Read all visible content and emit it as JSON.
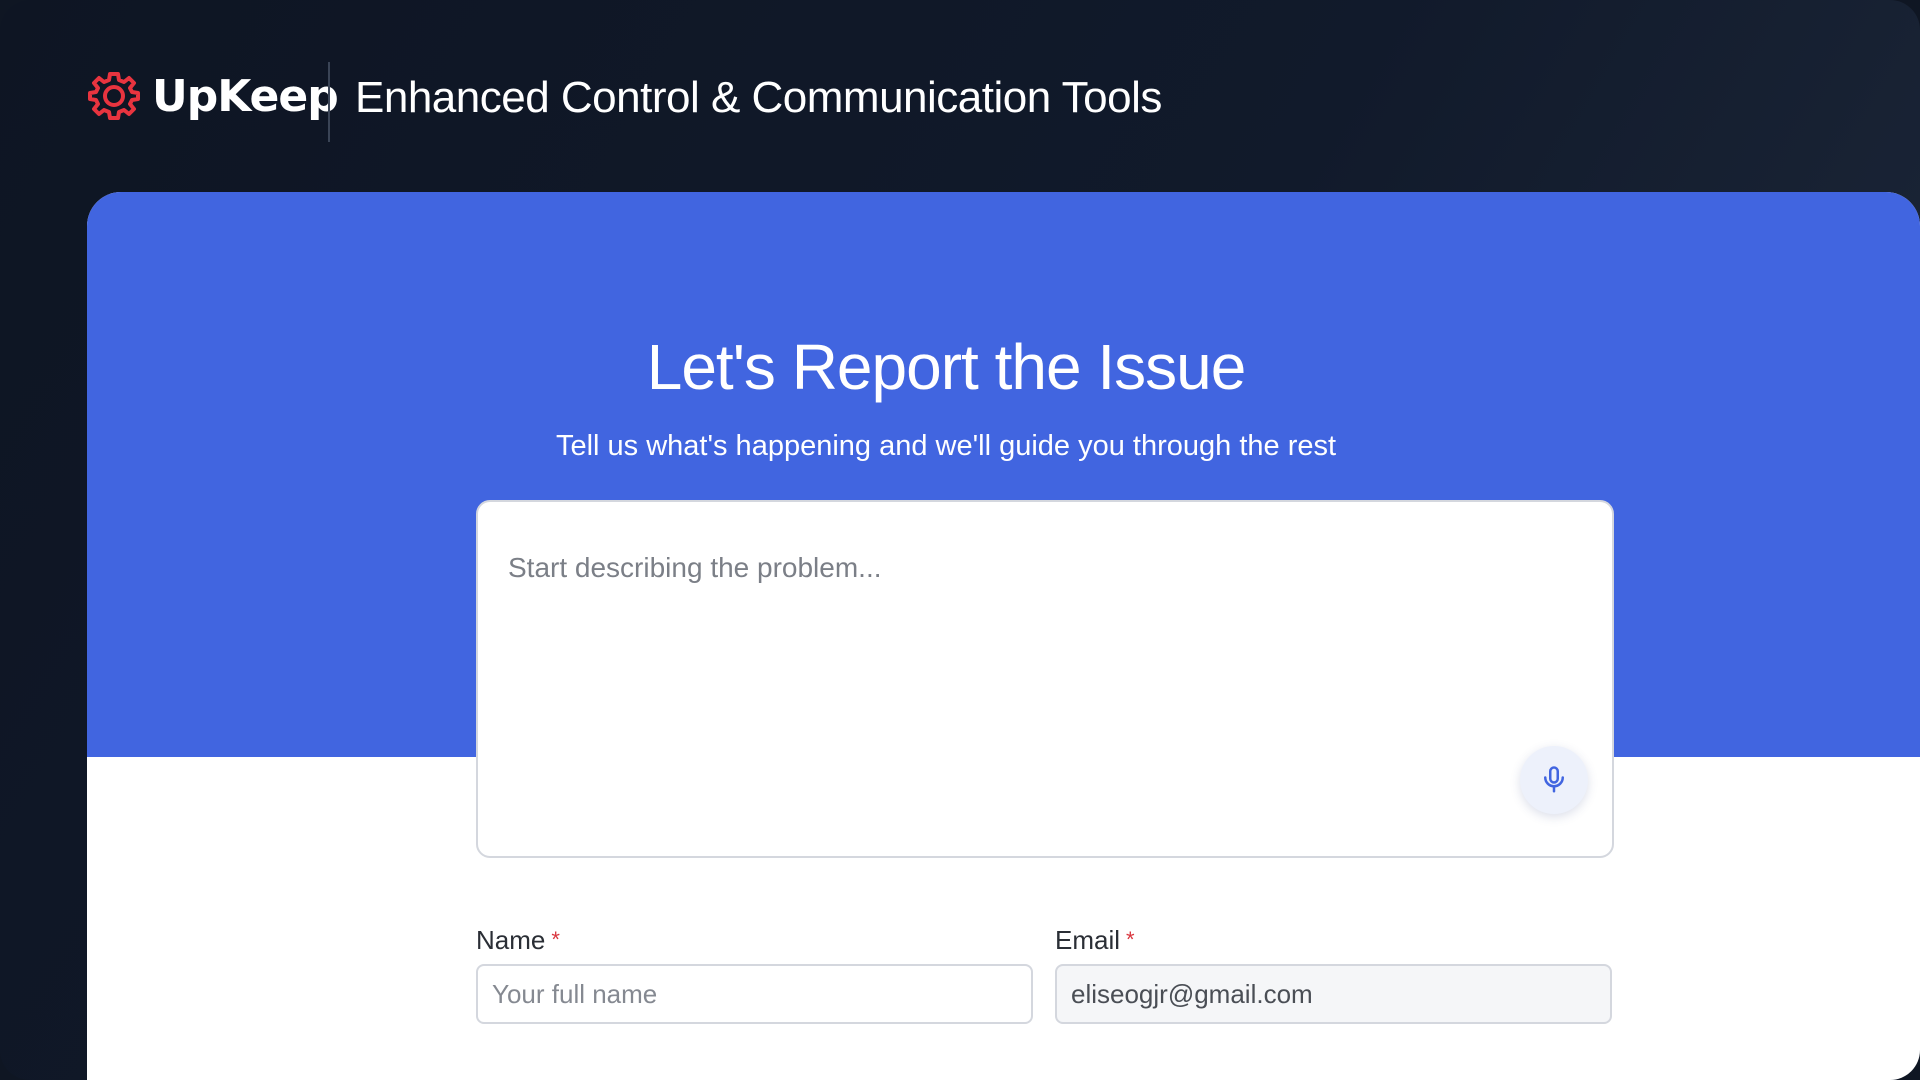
{
  "app": {
    "brand_name": "UpKeep",
    "header_title": "Enhanced Control & Communication Tools"
  },
  "hero": {
    "title": "Let's Report the Issue",
    "subtitle": "Tell us what's happening and we'll guide you through the rest"
  },
  "description": {
    "placeholder": "Start describing the problem...",
    "value": ""
  },
  "form": {
    "name_label": "Name",
    "name_placeholder": "Your full name",
    "name_value": "",
    "email_label": "Email",
    "email_value": "eliseogjr@gmail.com",
    "required_marker": "*"
  },
  "icons": {
    "logo": "gear-icon",
    "mic": "microphone-icon"
  },
  "colors": {
    "brand_red": "#e8343f",
    "hero_blue": "#4165e0",
    "header_bg": "#0f1623",
    "required_red": "#d9363e"
  }
}
